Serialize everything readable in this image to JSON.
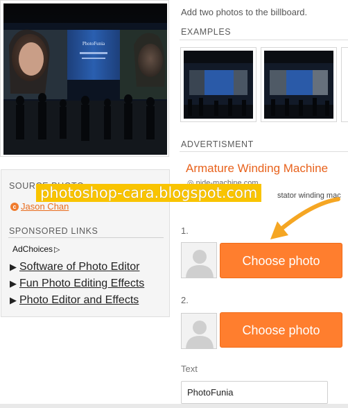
{
  "preview": {
    "billboard_text": "PhotoFunia"
  },
  "source": {
    "heading": "SOURCE PHOTO",
    "author": "Jason Chan",
    "author_icon": "cc-icon"
  },
  "sponsored": {
    "heading": "SPONSORED LINKS",
    "adchoices": "AdChoices",
    "links": [
      "Software of Photo Editor",
      "Fun Photo Editing Effects",
      "Photo Editor and Effects"
    ]
  },
  "effect": {
    "subtitle": "Add two photos to the billboard.",
    "examples_heading": "EXAMPLES"
  },
  "advert": {
    "heading": "ADVERTISMENT",
    "title": "Armature Winding Machine",
    "domain": "nide-machine.com",
    "snippet": "stator winding mac"
  },
  "watermark": "photoshop-cara.blogspot.com",
  "steps": [
    {
      "number": "1.",
      "button": "Choose photo"
    },
    {
      "number": "2.",
      "button": "Choose photo"
    }
  ],
  "text_field": {
    "label": "Text",
    "value": "PhotoFunia"
  },
  "colors": {
    "accent": "#ff7e2e",
    "link": "#e86b1c",
    "watermark_bg": "#f9c400"
  }
}
